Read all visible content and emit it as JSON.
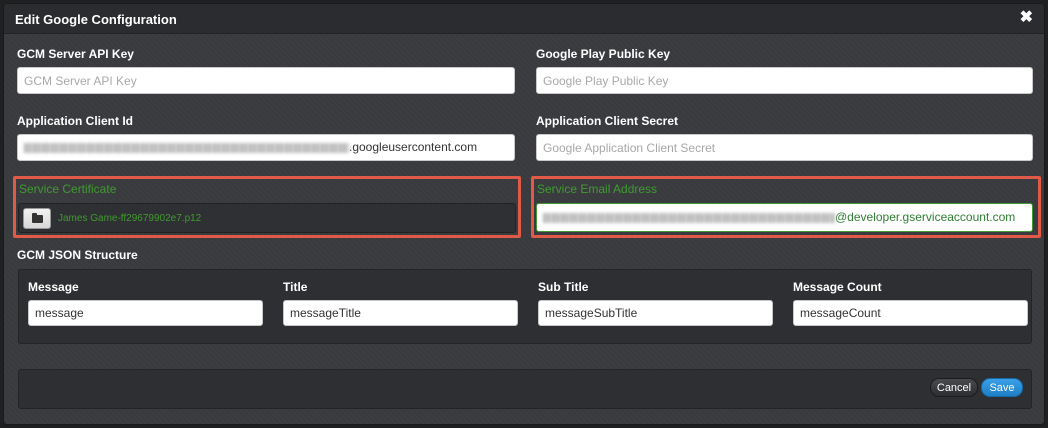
{
  "modal": {
    "title": "Edit Google Configuration",
    "close_icon": "close-icon"
  },
  "fields": {
    "gcm_server_api_key": {
      "label": "GCM Server API Key",
      "placeholder": "GCM Server API Key",
      "value": ""
    },
    "google_play_public_key": {
      "label": "Google Play Public Key",
      "placeholder": "Google Play Public Key",
      "value": ""
    },
    "application_client_id": {
      "label": "Application Client Id",
      "visible_suffix": ".googleusercontent.com"
    },
    "application_client_secret": {
      "label": "Application Client Secret",
      "placeholder": "Google Application Client Secret",
      "value": ""
    },
    "service_certificate": {
      "label": "Service Certificate",
      "file_name": "James Game-ff29679902e7.p12",
      "button_icon": "folder-open-icon"
    },
    "service_email_address": {
      "label": "Service Email Address",
      "visible_suffix": "@developer.gserviceaccount.com"
    }
  },
  "gcm_json": {
    "label": "GCM JSON Structure",
    "columns": [
      {
        "label": "Message",
        "value": "message"
      },
      {
        "label": "Title",
        "value": "messageTitle"
      },
      {
        "label": "Sub Title",
        "value": "messageSubTitle"
      },
      {
        "label": "Message Count",
        "value": "messageCount"
      }
    ]
  },
  "footer": {
    "cancel_label": "Cancel",
    "save_label": "Save"
  },
  "colors": {
    "highlight": "#e05a47",
    "success_green": "#3f9b2f",
    "primary_blue": "#2a8fd8",
    "modal_bg": "#3a3b3f"
  }
}
